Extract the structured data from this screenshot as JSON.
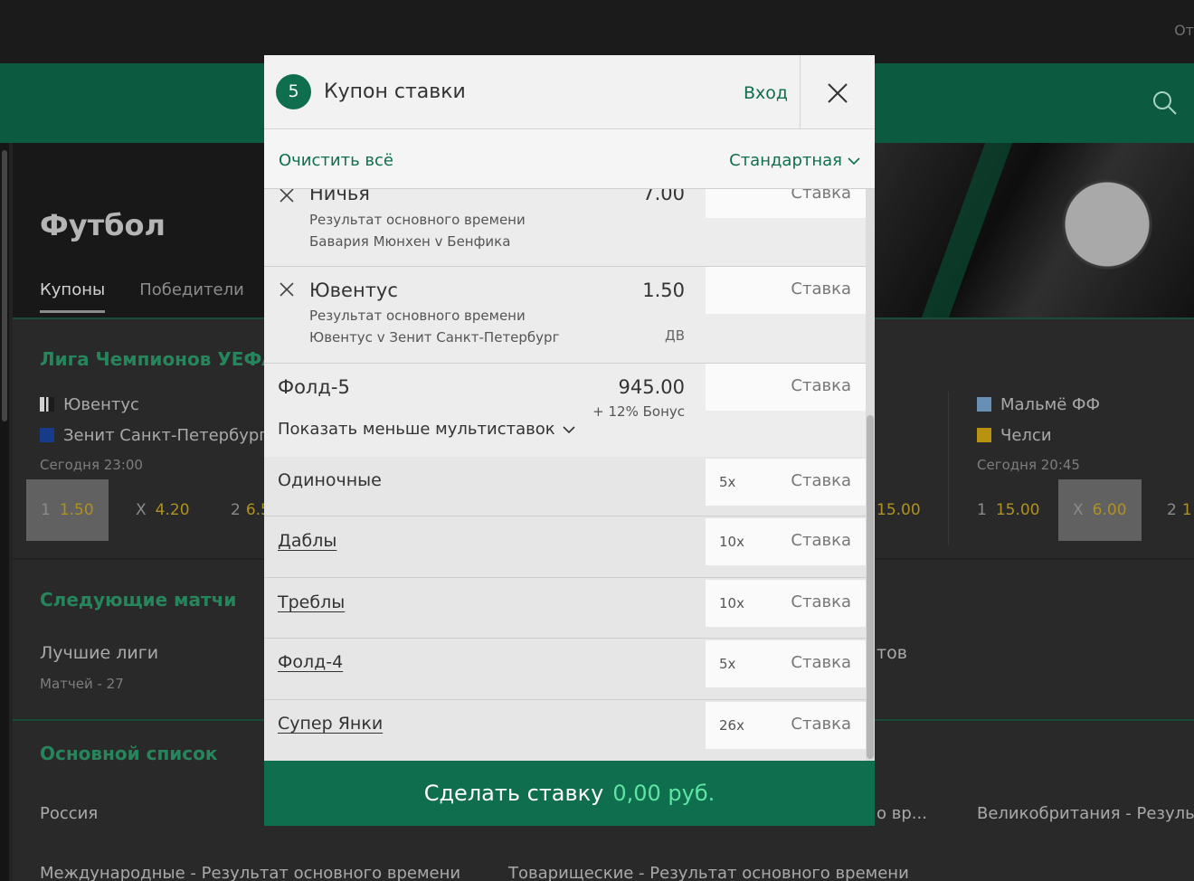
{
  "background": {
    "top_right_text": "От",
    "page_title": "Футбол",
    "tabs": [
      "Купоны",
      "Победители"
    ],
    "section1": {
      "title": "Лига Чемпионов УЕФА",
      "match1": {
        "home": "Ювентус",
        "away": "Зенит Санкт-Петербург",
        "time": "Сегодня 23:00",
        "odds": [
          {
            "label": "1",
            "value": "1.50"
          },
          {
            "label": "X",
            "value": "4.20"
          },
          {
            "label": "2",
            "value": "6.5"
          }
        ]
      },
      "partial_odd": "15.00",
      "match2": {
        "home": "Мальмё ФФ",
        "away": "Челси",
        "time": "Сегодня 20:45",
        "odds": [
          {
            "label": "1",
            "value": "15.00"
          },
          {
            "label": "X",
            "value": "6.00"
          },
          {
            "label": "2",
            "value": "1"
          }
        ]
      }
    },
    "section2": {
      "title": "Следующие матчи",
      "item": "Лучшие лиги",
      "sub": "Матчей - 27",
      "partial_right": "тов"
    },
    "section3": {
      "title": "Основной список",
      "row1": [
        "Россия",
        "о вр...",
        "Великобритания - Результа"
      ],
      "row2": [
        "Международные - Результат основного времени",
        "Товарищеские - Результат основного времени"
      ]
    }
  },
  "betslip": {
    "count": "5",
    "title": "Купон ставки",
    "login": "Вход",
    "clear_all": "Очистить всё",
    "bet_type": "Стандартная",
    "stake_placeholder": "Ставка",
    "selections": [
      {
        "name": "Ничья",
        "odds": "7.00",
        "market": "Результат основного времени",
        "event": "Бавария Мюнхен v Бенфика"
      },
      {
        "name": "Ювентус",
        "odds": "1.50",
        "market": "Результат основного времени",
        "event": "Ювентус v Зенит Санкт-Петербург",
        "tag": "ДВ"
      }
    ],
    "fold": {
      "name": "Фолд-5",
      "odds": "945.00",
      "bonus": "+ 12% Бонус",
      "show_less": "Показать меньше мультиставок"
    },
    "multiples": [
      {
        "name": "Одиночные",
        "multiplier": "5x"
      },
      {
        "name": "Даблы",
        "multiplier": "10x"
      },
      {
        "name": "Треблы",
        "multiplier": "10x"
      },
      {
        "name": "Фолд-4",
        "multiplier": "5x"
      },
      {
        "name": "Супер Янки",
        "multiplier": "26x"
      }
    ],
    "place_bet": {
      "label": "Сделать ставку",
      "amount": "0,00 руб."
    }
  }
}
